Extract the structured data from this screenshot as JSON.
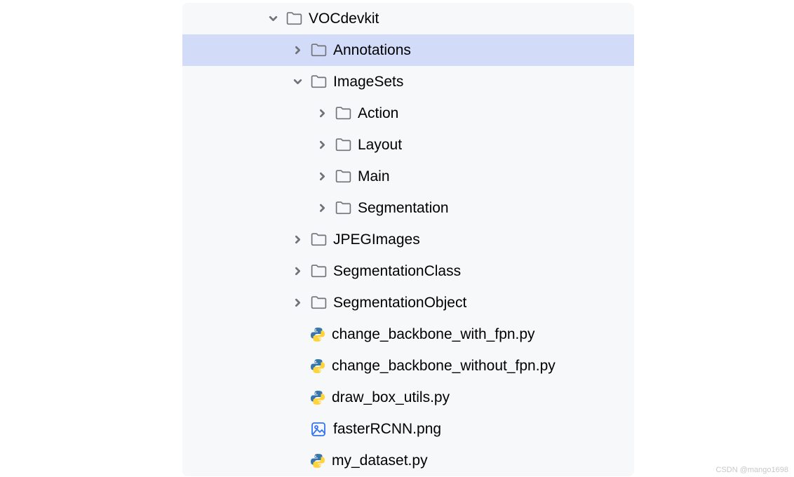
{
  "tree": {
    "items": [
      {
        "label": "VOCdevkit",
        "depth": 0,
        "kind": "folder",
        "expanded": true,
        "hasChildren": true,
        "selected": false
      },
      {
        "label": "Annotations",
        "depth": 1,
        "kind": "folder",
        "expanded": false,
        "hasChildren": true,
        "selected": true
      },
      {
        "label": "ImageSets",
        "depth": 1,
        "kind": "folder",
        "expanded": true,
        "hasChildren": true,
        "selected": false
      },
      {
        "label": "Action",
        "depth": 2,
        "kind": "folder",
        "expanded": false,
        "hasChildren": true,
        "selected": false
      },
      {
        "label": "Layout",
        "depth": 2,
        "kind": "folder",
        "expanded": false,
        "hasChildren": true,
        "selected": false
      },
      {
        "label": "Main",
        "depth": 2,
        "kind": "folder",
        "expanded": false,
        "hasChildren": true,
        "selected": false
      },
      {
        "label": "Segmentation",
        "depth": 2,
        "kind": "folder",
        "expanded": false,
        "hasChildren": true,
        "selected": false
      },
      {
        "label": "JPEGImages",
        "depth": 1,
        "kind": "folder",
        "expanded": false,
        "hasChildren": true,
        "selected": false
      },
      {
        "label": "SegmentationClass",
        "depth": 1,
        "kind": "folder",
        "expanded": false,
        "hasChildren": true,
        "selected": false
      },
      {
        "label": "SegmentationObject",
        "depth": 1,
        "kind": "folder",
        "expanded": false,
        "hasChildren": true,
        "selected": false
      },
      {
        "label": "change_backbone_with_fpn.py",
        "depth": 1,
        "kind": "python",
        "expanded": false,
        "hasChildren": false,
        "selected": false
      },
      {
        "label": "change_backbone_without_fpn.py",
        "depth": 1,
        "kind": "python",
        "expanded": false,
        "hasChildren": false,
        "selected": false
      },
      {
        "label": "draw_box_utils.py",
        "depth": 1,
        "kind": "python",
        "expanded": false,
        "hasChildren": false,
        "selected": false
      },
      {
        "label": "fasterRCNN.png",
        "depth": 1,
        "kind": "image",
        "expanded": false,
        "hasChildren": false,
        "selected": false
      },
      {
        "label": "my_dataset.py",
        "depth": 1,
        "kind": "python",
        "expanded": false,
        "hasChildren": false,
        "selected": false
      }
    ]
  },
  "baseIndent": 120,
  "indentStep": 35,
  "watermark": "CSDN @mango1698"
}
